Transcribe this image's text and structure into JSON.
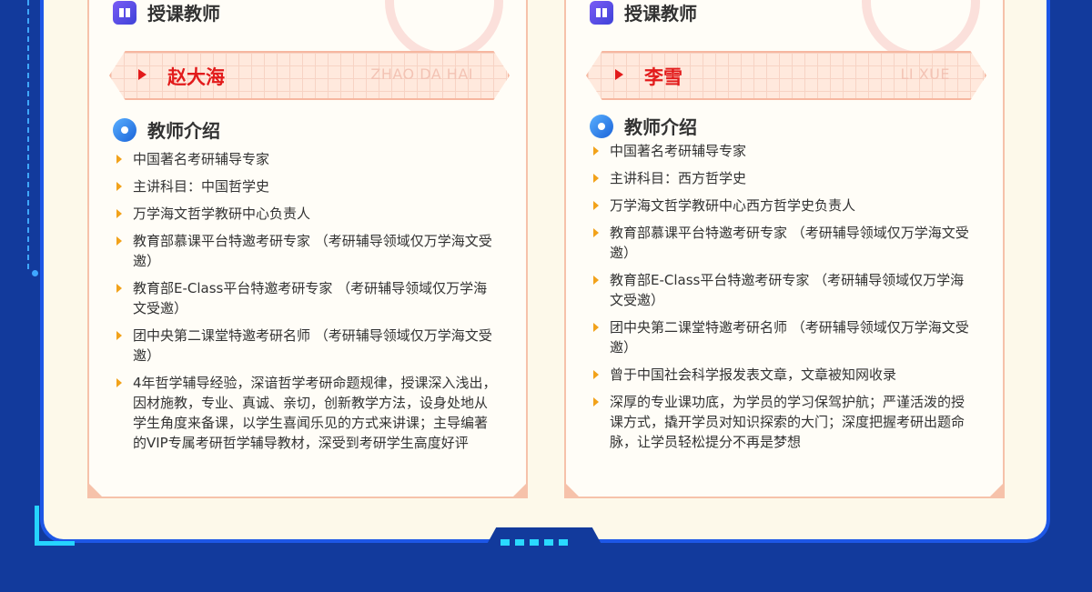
{
  "colors": {
    "background": "#123a9c",
    "panel": "#fdf9ea",
    "accent_red": "#e21b1b",
    "bullet": "#f2a21a",
    "card_border": "#f6c2aa",
    "cyan": "#25d4ff"
  },
  "cards": [
    {
      "section_teacher": "授课教师",
      "name": "赵大海",
      "pinyin": "ZHAO DA HAI",
      "section_intro": "教师介绍",
      "items": [
        "中国著名考研辅导专家",
        "主讲科目：中国哲学史",
        "万学海文哲学教研中心负责人",
        "教育部慕课平台特邀考研专家 （考研辅导领域仅万学海文受邀）",
        "教育部E-Class平台特邀考研专家 （考研辅导领域仅万学海文受邀）",
        "团中央第二课堂特邀考研名师 （考研辅导领域仅万学海文受邀）",
        "4年哲学辅导经验，深谙哲学考研命题规律，授课深入浅出，因材施教，专业、真诚、亲切，创新教学方法，设身处地从学生角度来备课，以学生喜闻乐见的方式来讲课；主导编著的VIP专属考研哲学辅导教材，深受到考研学生高度好评"
      ]
    },
    {
      "section_teacher": "授课教师",
      "name": "李雪",
      "pinyin": "LI XUE",
      "section_intro": "教师介绍",
      "items": [
        "中国著名考研辅导专家",
        "主讲科目：西方哲学史",
        "万学海文哲学教研中心西方哲学史负责人",
        "教育部慕课平台特邀考研专家 （考研辅导领域仅万学海文受邀）",
        "教育部E-Class平台特邀考研专家 （考研辅导领域仅万学海文受邀）",
        "团中央第二课堂特邀考研名师 （考研辅导领域仅万学海文受邀）",
        "曾于中国社会科学报发表文章，文章被知网收录",
        "深厚的专业课功底，为学员的学习保驾护航；严谨活泼的授课方式，撬开学员对知识探索的大门；深度把握考研出题命脉，让学员轻松提分不再是梦想"
      ]
    }
  ]
}
